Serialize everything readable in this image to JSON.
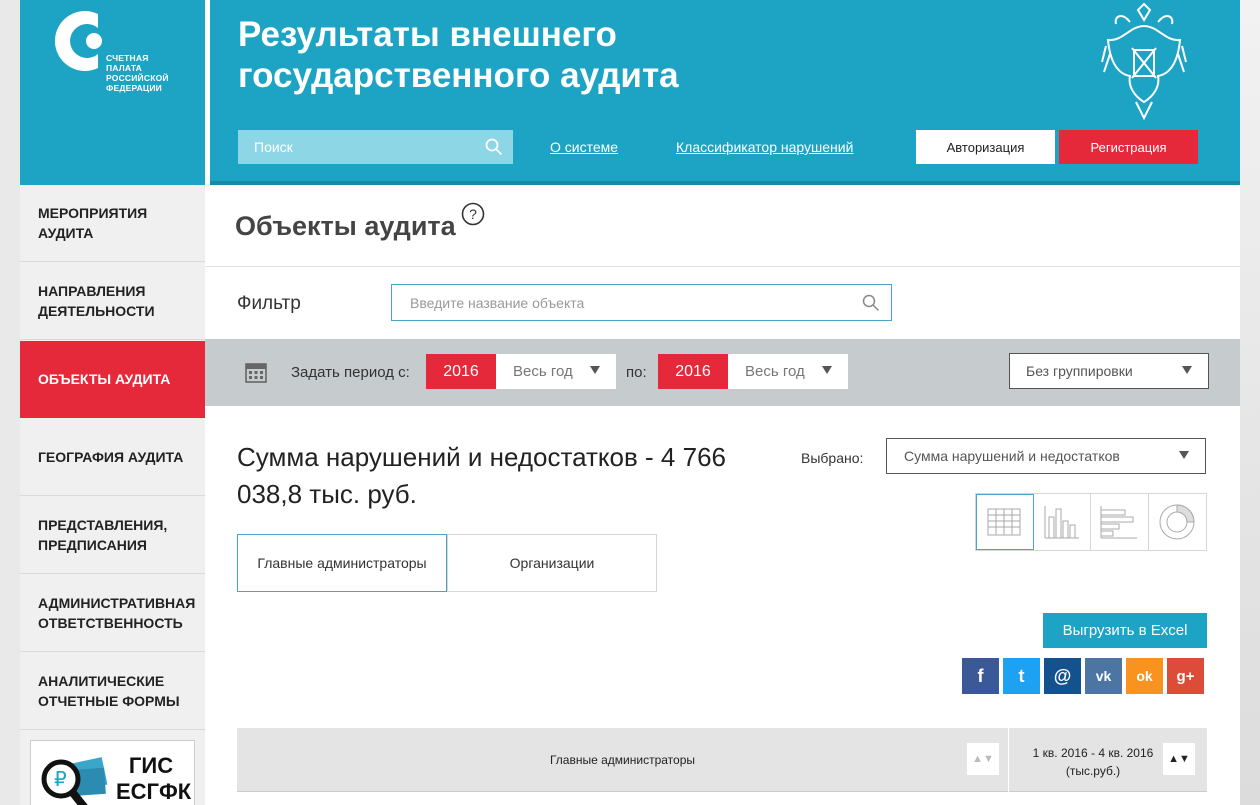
{
  "logo": {
    "text": "СЧЕТНАЯ ПАЛАТА РОССИЙСКОЙ ФЕДЕРАЦИИ",
    "color": "#1da4c4"
  },
  "header": {
    "title": "Результаты внешнего государственного аудита",
    "search_placeholder": "Поиск",
    "links": [
      "О системе",
      "Классификатор нарушений"
    ],
    "auth_label": "Авторизация",
    "register_label": "Регистрация"
  },
  "sidebar": {
    "items": [
      "Мероприятия аудита",
      "Направления деятельности",
      "Объекты аудита",
      "География аудита",
      "Представления, предписания",
      "Административная ответственность",
      "Аналитические отчетные формы"
    ],
    "active_index": 2,
    "gis_label": "ГИС ЕСГФК"
  },
  "page": {
    "title": "Объекты аудита",
    "filter_label": "Фильтр",
    "filter_placeholder": "Введите название объекта",
    "period_label": "Задать период с:",
    "from_year": "2016",
    "from_range": "Весь год",
    "to_label": "по:",
    "to_year": "2016",
    "to_range": "Весь год",
    "grouping": "Без группировки",
    "sum_title": "Сумма нарушений и недостатков - 4 766 038,8 тыс. руб.",
    "chosen_label": "Выбрано:",
    "chosen_value": "Сумма нарушений и недостатков",
    "tabs": [
      "Главные администраторы",
      "Организации"
    ],
    "excel_label": "Выгрузить в Excel",
    "social": [
      {
        "name": "facebook",
        "glyph": "f",
        "color": "#3b5998"
      },
      {
        "name": "twitter",
        "glyph": "t",
        "color": "#1da1f2"
      },
      {
        "name": "mail",
        "glyph": "@",
        "color": "#14518f"
      },
      {
        "name": "vk",
        "glyph": "vk",
        "color": "#4c75a3"
      },
      {
        "name": "odnoklassniki",
        "glyph": "ok",
        "color": "#f7931e"
      },
      {
        "name": "google-plus",
        "glyph": "g+",
        "color": "#dd4b39"
      }
    ]
  },
  "table": {
    "col_main": "Главные администраторы",
    "col_period": "1 кв. 2016 - 4 кв. 2016",
    "col_unit": "(тыс.руб.)"
  }
}
